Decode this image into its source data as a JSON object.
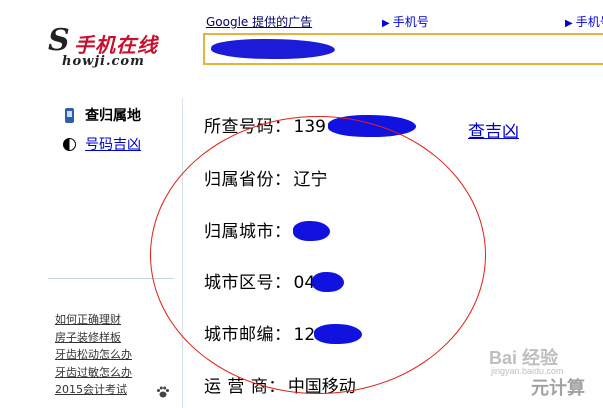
{
  "header": {
    "logo_mark": "S",
    "logo_text": "手机在线",
    "logo_domain": "howji.com",
    "ad_label": "Google 提供的广告",
    "nav_links": [
      "手机号",
      "手机号"
    ],
    "search_value": ""
  },
  "sidebar": {
    "items": [
      {
        "label": "查归属地",
        "icon": "phone-icon",
        "current": true
      },
      {
        "label": "号码吉凶",
        "icon": "yinyang-icon",
        "current": false
      }
    ],
    "links": [
      "如何正确理财",
      "房子装修样板",
      "牙齿松动怎么办",
      "牙齿过敏怎么办",
      "2015会计考试"
    ]
  },
  "results": {
    "rows": [
      {
        "label": "所查号码：",
        "value": "139"
      },
      {
        "label": "归属省份：",
        "value": "辽宁"
      },
      {
        "label": "归属城市：",
        "value": ""
      },
      {
        "label": "城市区号：",
        "value": "04"
      },
      {
        "label": "城市邮编：",
        "value": "12"
      },
      {
        "label": "运 营 商：",
        "value": "中国移动"
      }
    ],
    "check_link": "查吉凶"
  },
  "watermark": {
    "brand": "Bai 经验",
    "site": "jingyan.baidu.com",
    "tag": "元计算"
  },
  "colors": {
    "logo_red": "#c8102e",
    "link_blue": "#0000cc",
    "search_border": "#e5b23c",
    "circle_red": "#e0201a",
    "redaction_blue": "#1212e0"
  }
}
